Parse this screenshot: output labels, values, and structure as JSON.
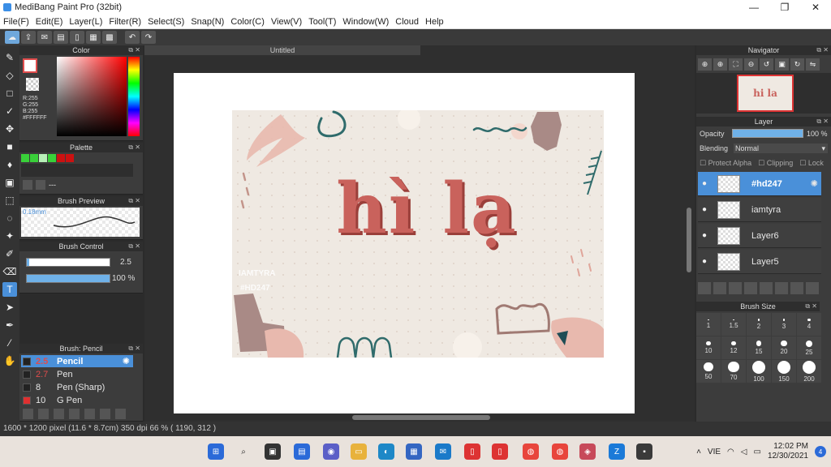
{
  "window": {
    "title": "MediBang Paint Pro (32bit)",
    "min": "—",
    "max": "❐",
    "close": "✕"
  },
  "menu": [
    "File(F)",
    "Edit(E)",
    "Layer(L)",
    "Filter(R)",
    "Select(S)",
    "Snap(N)",
    "Color(C)",
    "View(V)",
    "Tool(T)",
    "Window(W)",
    "Cloud",
    "Help"
  ],
  "panels": {
    "color": "Color",
    "palette": "Palette",
    "brush_preview": "Brush Preview",
    "brush_control": "Brush Control",
    "brush_list": "Brush: Pencil",
    "navigator": "Navigator",
    "layer": "Layer",
    "brush_size": "Brush Size"
  },
  "color": {
    "r": "R:255",
    "g": "G:255",
    "b": "B:255",
    "hex": "#FFFFFF",
    "fg": "#ffffff",
    "accent": "#e04c4c"
  },
  "palette": {
    "swatches": [
      "#39d039",
      "#39d039",
      "#b7f0b7",
      "#39d039",
      "#cc1111",
      "#cc1111"
    ],
    "more": "---"
  },
  "brush_preview": {
    "size": "0.18mm"
  },
  "brush_control": {
    "size": "2.5",
    "opacity": "100 %",
    "size_fraction": 0.03,
    "opacity_fraction": 1.0
  },
  "brushes": [
    {
      "size": "2.5",
      "name": "Pencil",
      "active": true,
      "color": "#e04c4c"
    },
    {
      "size": "2.7",
      "name": "Pen",
      "active": false,
      "color": "#e04c4c"
    },
    {
      "size": "8",
      "name": "Pen (Sharp)",
      "active": false,
      "color": "#e6e6e6"
    },
    {
      "size": "10",
      "name": "G Pen",
      "active": false,
      "color": "#e6e6e6"
    }
  ],
  "document": {
    "tab": "Untitled",
    "thumb_text": "hi la"
  },
  "artwork": {
    "title": "hì lạ",
    "watermark1": "IAMTYRA",
    "watermark2": "#HD247",
    "bg": "#efe9e2",
    "text_color": "#c9625c"
  },
  "layer": {
    "opacity_label": "Opacity",
    "opacity_value": "100 %",
    "blending_label": "Blending",
    "blending_value": "Normal",
    "protect_alpha": "Protect Alpha",
    "clipping": "Clipping",
    "lock": "Lock",
    "items": [
      {
        "name": "#hd247",
        "active": true
      },
      {
        "name": "iamtyra",
        "active": false
      },
      {
        "name": "Layer6",
        "active": false
      },
      {
        "name": "Layer5",
        "active": false
      }
    ]
  },
  "brush_sizes": [
    "1",
    "1.5",
    "2",
    "3",
    "4",
    "10",
    "12",
    "15",
    "20",
    "25",
    "50",
    "70",
    "100",
    "150",
    "200"
  ],
  "status": "1600 * 1200 pixel  (11.6 * 8.7cm)  350 dpi  66 %  ( 1190, 312 )",
  "tray": {
    "lang": "VIE",
    "time": "12:02 PM",
    "date": "12/30/2021",
    "notif": "4"
  }
}
